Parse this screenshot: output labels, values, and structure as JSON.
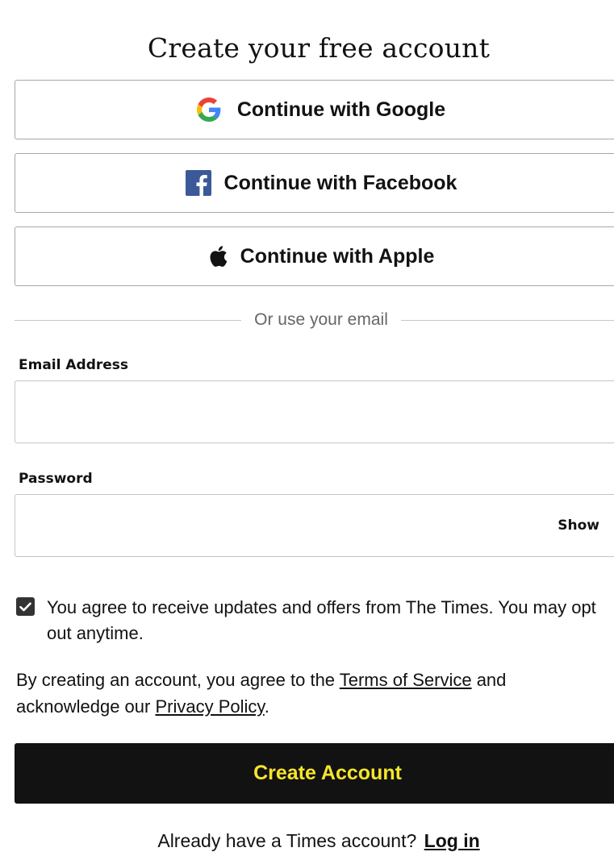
{
  "page": {
    "title": "Create your free account"
  },
  "sso": {
    "google_label": "Continue with Google",
    "facebook_label": "Continue with Facebook",
    "apple_label": "Continue with Apple",
    "icons": {
      "google": "google-icon",
      "facebook": "facebook-icon",
      "apple": "apple-icon"
    }
  },
  "divider": {
    "text": "Or use your email"
  },
  "email": {
    "label": "Email Address",
    "value": ""
  },
  "password": {
    "label": "Password",
    "value": "",
    "show_label": "Show"
  },
  "consent": {
    "checked": true,
    "text": "You agree to receive updates and offers from The Times. You may opt out anytime."
  },
  "terms": {
    "prefix": "By creating an account, you agree to the ",
    "terms_link": "Terms of Service",
    "middle": " and acknowledge our ",
    "privacy_link": "Privacy Policy",
    "suffix": "."
  },
  "create_button": {
    "label": "Create Account"
  },
  "login": {
    "prompt": "Already have a Times account? ",
    "link": "Log in"
  },
  "colors": {
    "primary_button_bg": "#121212",
    "primary_button_text": "#f5e52b",
    "facebook_blue": "#3b5998",
    "checkbox_bg": "#333333"
  }
}
